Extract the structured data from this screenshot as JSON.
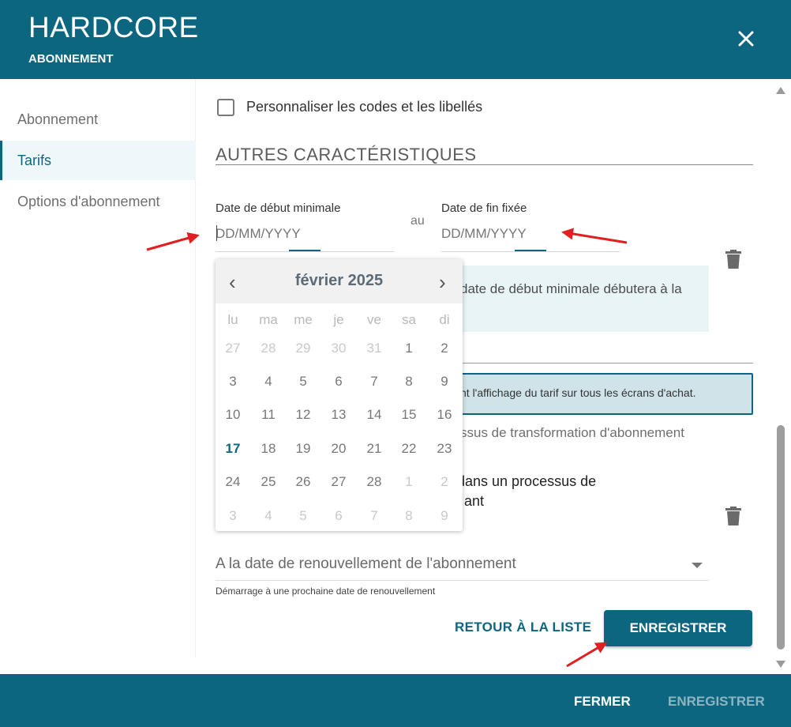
{
  "header": {
    "title": "HARDCORE",
    "subtitle": "ABONNEMENT"
  },
  "sidebar": {
    "items": [
      {
        "label": "Abonnement"
      },
      {
        "label": "Tarifs"
      },
      {
        "label": "Options d'abonnement"
      }
    ]
  },
  "form": {
    "checkbox_label": "Personnaliser les codes et les libellés",
    "section_title": "AUTRES CARACTÉRISTIQUES",
    "start_label": "Date de début minimale",
    "start_placeholder": "DD/MM/YYYY",
    "connector": "au",
    "end_label": "Date de fin fixée",
    "end_placeholder": "DD/MM/YYYY",
    "info_text": "date de début minimale débutera à la",
    "alert_text": "nt l'affichage du tarif sur tous les écrans d'achat.",
    "process_text": "ssus de transformation d'abonnement",
    "process2_line1": "dans un processus de",
    "process2_line2": "ant",
    "select_value": "A la date de renouvellement de l'abonnement",
    "select_hint": "Démarrage à une prochaine date de renouvellement",
    "back_label": "RETOUR À LA LISTE",
    "save_label": "ENREGISTRER"
  },
  "footer": {
    "close_label": "FERMER",
    "save_label": "ENREGISTRER"
  },
  "calendar": {
    "month_label": "février 2025",
    "prev": "‹",
    "next": "›",
    "weekdays": [
      "lu",
      "ma",
      "me",
      "je",
      "ve",
      "sa",
      "di"
    ],
    "weeks": [
      [
        "27",
        "28",
        "29",
        "30",
        "31",
        "1",
        "2"
      ],
      [
        "3",
        "4",
        "5",
        "6",
        "7",
        "8",
        "9"
      ],
      [
        "10",
        "11",
        "12",
        "13",
        "14",
        "15",
        "16"
      ],
      [
        "17",
        "18",
        "19",
        "20",
        "21",
        "22",
        "23"
      ],
      [
        "24",
        "25",
        "26",
        "27",
        "28",
        "1",
        "2"
      ],
      [
        "3",
        "4",
        "5",
        "6",
        "7",
        "8",
        "9"
      ]
    ],
    "outside_month": [
      [
        1,
        1,
        1,
        1,
        1,
        0,
        0
      ],
      [
        0,
        0,
        0,
        0,
        0,
        0,
        0
      ],
      [
        0,
        0,
        0,
        0,
        0,
        0,
        0
      ],
      [
        0,
        0,
        0,
        0,
        0,
        0,
        0
      ],
      [
        0,
        0,
        0,
        0,
        0,
        1,
        1
      ],
      [
        1,
        1,
        1,
        1,
        1,
        1,
        1
      ]
    ],
    "today": "17"
  },
  "icons": {
    "close": "close-icon",
    "trash": "trash-icon",
    "dropdown": "chevron-down-icon"
  },
  "colors": {
    "brand": "#0d6680",
    "highlight": "#e8f4f6",
    "alert_bg": "#cfe3e8",
    "annotation": "#e02020"
  }
}
